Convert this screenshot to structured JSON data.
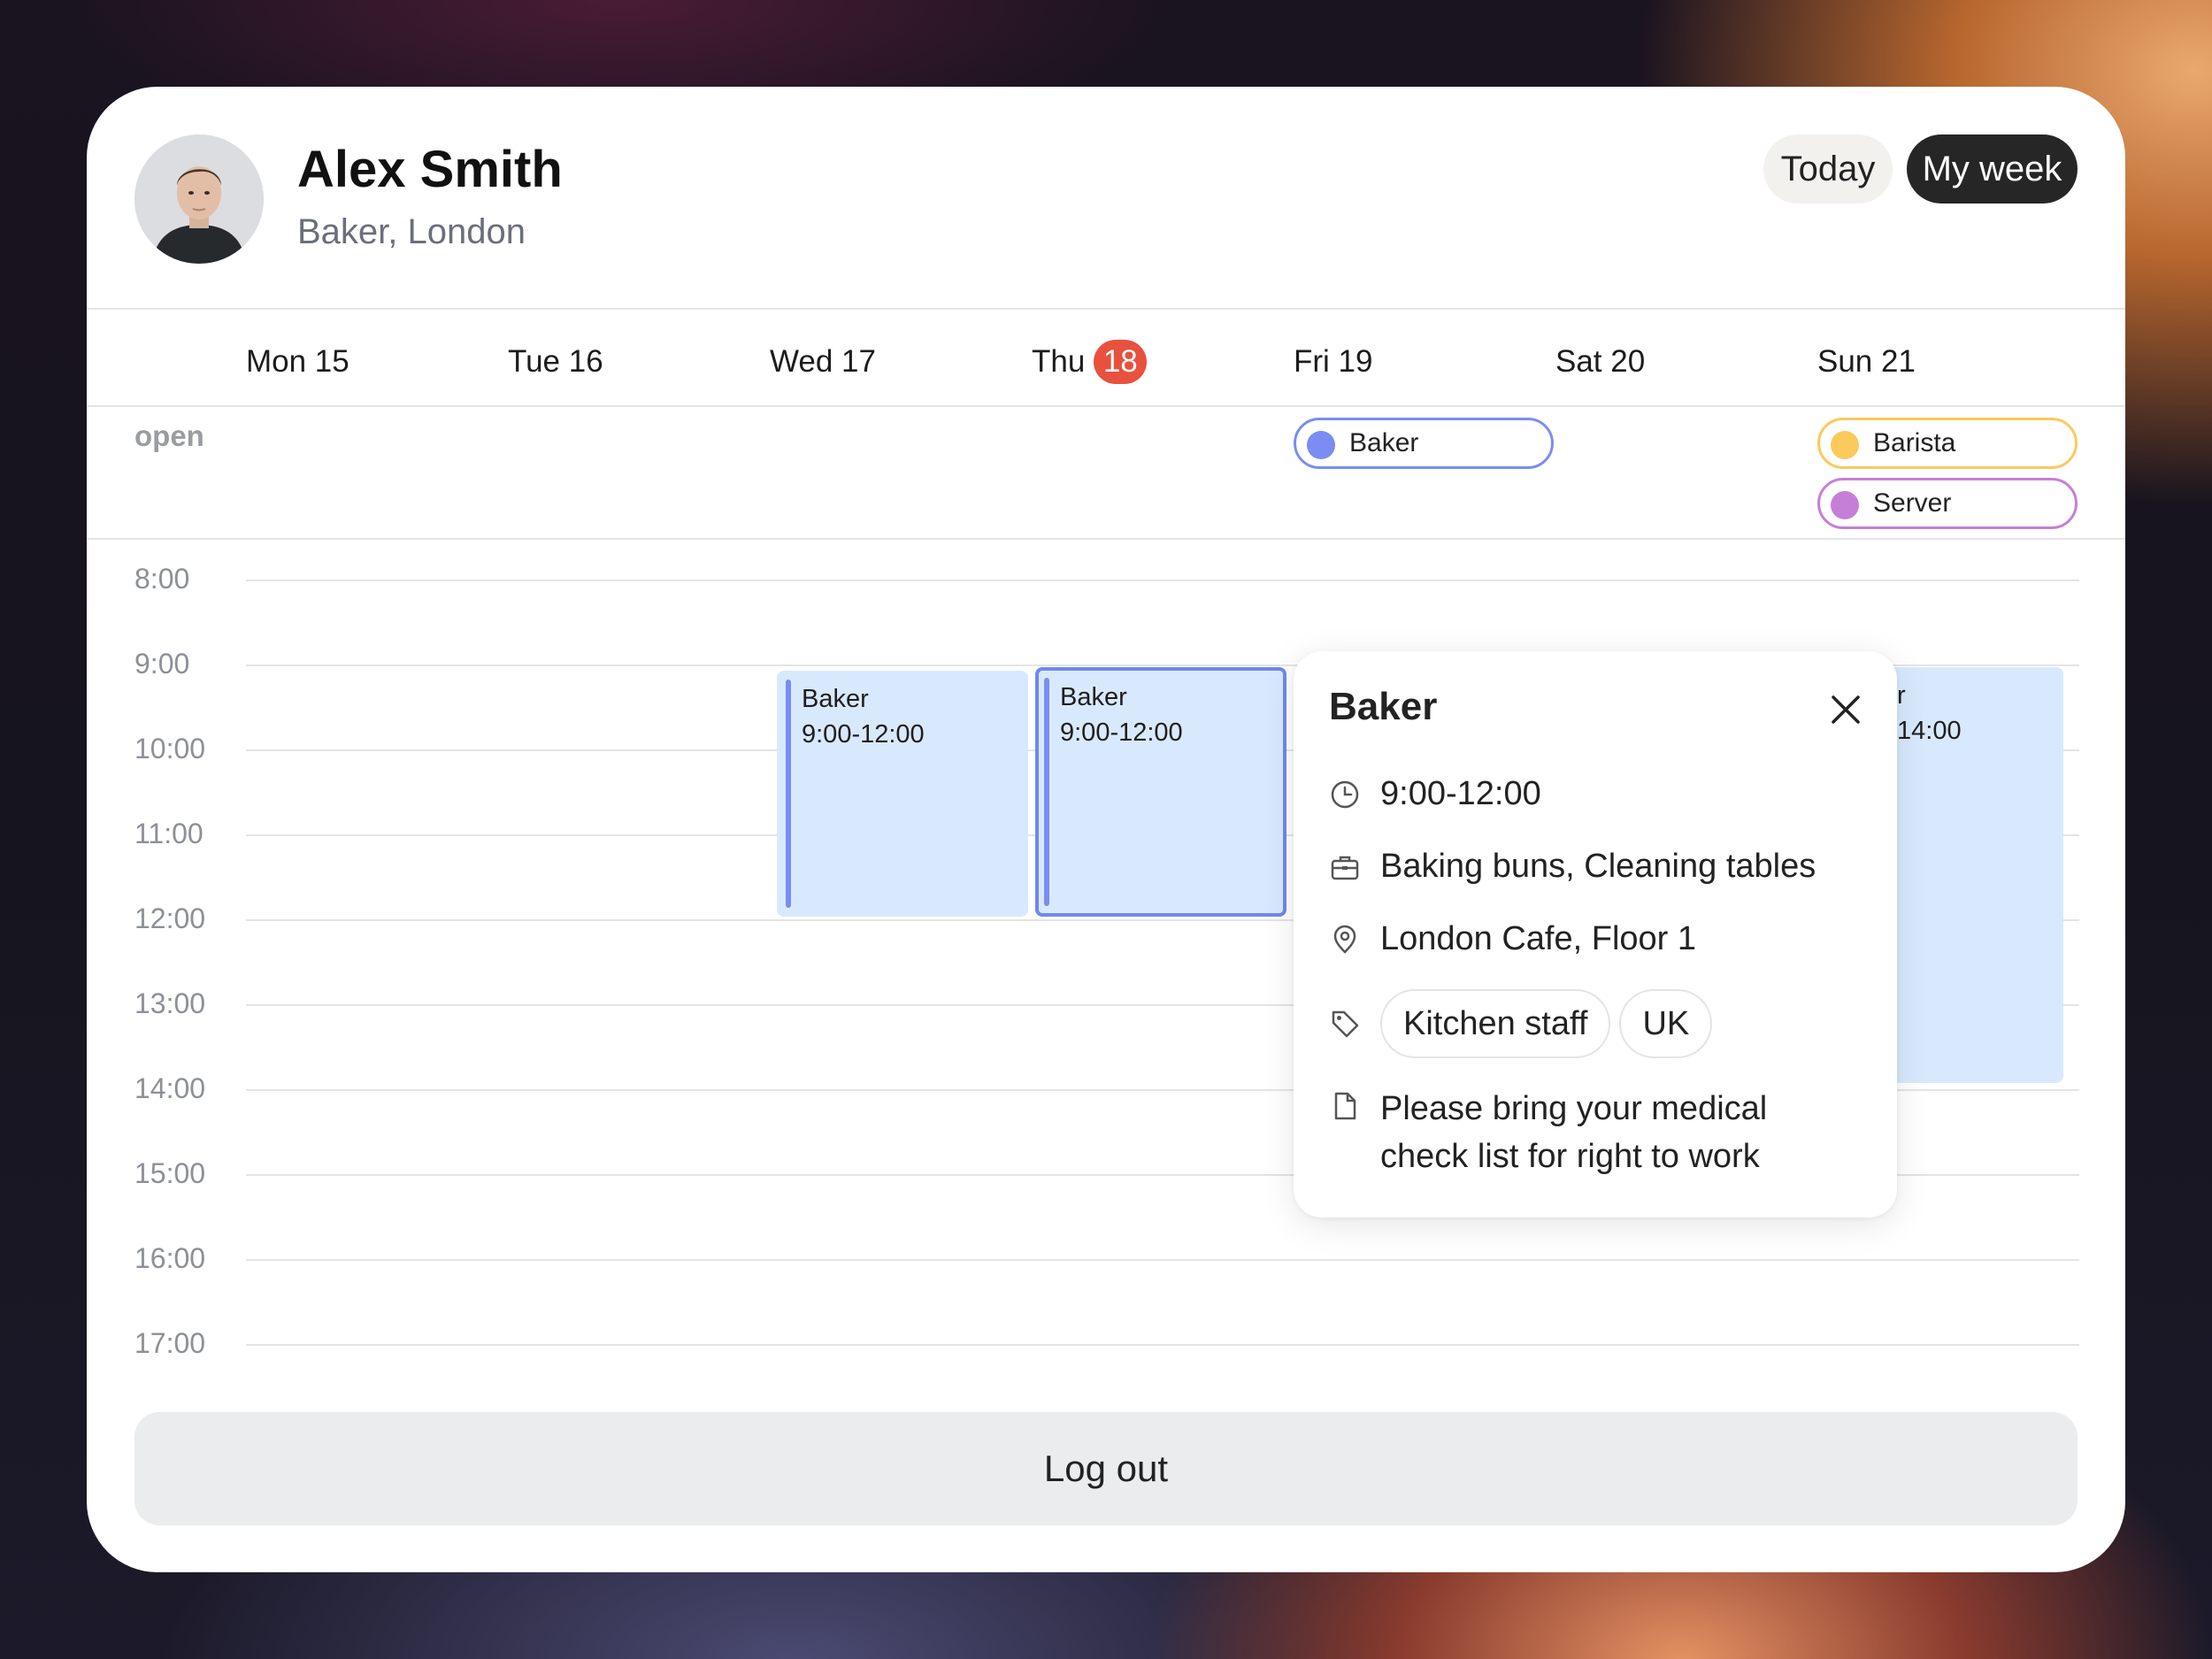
{
  "profile": {
    "name": "Alex Smith",
    "role": "Baker, London"
  },
  "view_buttons": {
    "today": "Today",
    "my_week": "My week"
  },
  "days": [
    {
      "label": "Mon 15"
    },
    {
      "label": "Tue 16"
    },
    {
      "label": "Wed 17"
    },
    {
      "label": "Thu",
      "badge": "18"
    },
    {
      "label": "Fri 19"
    },
    {
      "label": "Sat 20"
    },
    {
      "label": "Sun 21"
    }
  ],
  "open_shifts": {
    "label": "open",
    "chips": [
      {
        "label": "Baker",
        "color": "#7b8cf2"
      },
      {
        "label": "Barista",
        "color": "#fbc95c"
      },
      {
        "label": "Server",
        "color": "#c67fd6"
      }
    ]
  },
  "times": [
    "8:00",
    "9:00",
    "10:00",
    "11:00",
    "12:00",
    "13:00",
    "14:00",
    "15:00",
    "16:00",
    "17:00"
  ],
  "shifts": [
    {
      "role": "Baker",
      "time": "9:00-12:00"
    },
    {
      "role": "Baker",
      "time": "9:00-12:00"
    },
    {
      "role": "r",
      "time": "14:00"
    }
  ],
  "popup": {
    "title": "Baker",
    "time": "9:00-12:00",
    "tasks": "Baking buns, Cleaning tables",
    "location": "London Cafe, Floor 1",
    "tags": [
      "Kitchen staff",
      "UK"
    ],
    "note_line1": "Please bring your medical",
    "note_line2": "check list for right to work"
  },
  "logout": "Log out",
  "colors": {
    "accent": "#7b8cf2",
    "today_badge": "#e7513d",
    "shift_fill": "#d9e9fd"
  }
}
